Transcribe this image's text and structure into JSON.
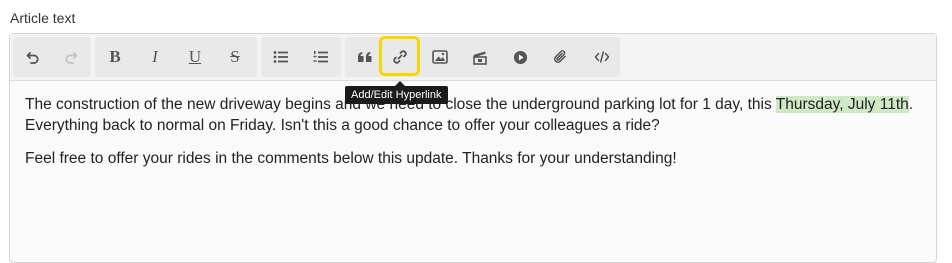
{
  "field": {
    "label": "Article text"
  },
  "toolbar": {
    "buttons": [
      {
        "name": "undo",
        "icon": "undo-icon"
      },
      {
        "name": "redo",
        "icon": "redo-icon"
      },
      {
        "name": "bold",
        "text": "B"
      },
      {
        "name": "italic",
        "text": "I"
      },
      {
        "name": "underline",
        "text": "U"
      },
      {
        "name": "strikethrough",
        "text": "S"
      },
      {
        "name": "bullet-list",
        "icon": "bullet-list-icon"
      },
      {
        "name": "numbered-list",
        "icon": "numbered-list-icon"
      },
      {
        "name": "blockquote",
        "icon": "quote-icon"
      },
      {
        "name": "hyperlink",
        "icon": "link-icon"
      },
      {
        "name": "image",
        "icon": "image-icon"
      },
      {
        "name": "media",
        "icon": "media-icon"
      },
      {
        "name": "video",
        "icon": "play-icon"
      },
      {
        "name": "attachment",
        "icon": "paperclip-icon"
      },
      {
        "name": "source-code",
        "icon": "code-icon"
      }
    ],
    "tooltip": "Add/Edit Hyperlink"
  },
  "content": {
    "paragraph1_before": "The construction of the new driveway begins and we need to close the underground parking lot for 1 day, this ",
    "paragraph1_highlight": "Thursday, July 11th",
    "paragraph1_after": ". Everything back to normal on Friday. Isn't this a good chance to offer your colleagues a ride?",
    "paragraph2": "Feel free to offer your rides in the comments below this update. Thanks for your understanding!"
  },
  "colors": {
    "highlight": "#cfe8c6",
    "focus_ring": "#f6d800",
    "tooltip_bg": "#1b1b1b"
  }
}
